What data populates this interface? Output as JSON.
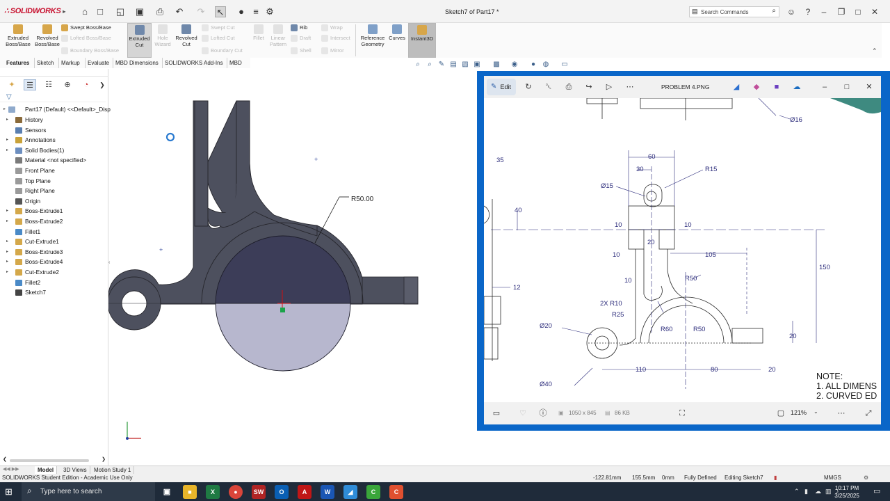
{
  "app": {
    "name": "SOLIDWORKS",
    "document_title": "Sketch7 of Part17 *"
  },
  "search": {
    "placeholder": "Search Commands"
  },
  "command_manager": {
    "extruded_boss": "Extruded\nBoss/Base",
    "revolved_boss": "Revolved\nBoss/Base",
    "swept_boss": "Swept Boss/Base",
    "lofted_boss": "Lofted Boss/Base",
    "boundary_boss": "Boundary Boss/Base",
    "extruded_cut": "Extruded\nCut",
    "hole_wizard": "Hole\nWizard",
    "revolved_cut": "Revolved\nCut",
    "swept_cut": "Swept Cut",
    "lofted_cut": "Lofted Cut",
    "boundary_cut": "Boundary Cut",
    "fillet": "Fillet",
    "linear_pattern": "Linear\nPattern",
    "rib": "Rib",
    "draft": "Draft",
    "shell": "Shell",
    "wrap": "Wrap",
    "intersect": "Intersect",
    "mirror": "Mirror",
    "reference_geometry": "Reference\nGeometry",
    "curves": "Curves",
    "instant3d": "Instant3D"
  },
  "tabs": [
    "Features",
    "Sketch",
    "Markup",
    "Evaluate",
    "MBD Dimensions",
    "SOLIDWORKS Add-Ins",
    "MBD"
  ],
  "tree": {
    "root": "Part17 (Default) <<Default>_Disp",
    "items": [
      {
        "label": "History",
        "arrow": true,
        "icon": "history-icon",
        "color": "#8a6a3a"
      },
      {
        "label": "Sensors",
        "arrow": false,
        "icon": "sensors-icon",
        "color": "#5a7fb0"
      },
      {
        "label": "Annotations",
        "arrow": true,
        "icon": "annotations-icon",
        "color": "#c9a23a"
      },
      {
        "label": "Solid Bodies(1)",
        "arrow": true,
        "icon": "solid-bodies-icon",
        "color": "#6c8ebf"
      },
      {
        "label": "Material <not specified>",
        "arrow": false,
        "icon": "material-icon",
        "color": "#7a7a7a"
      },
      {
        "label": "Front Plane",
        "arrow": false,
        "icon": "plane-icon",
        "color": "#9a9a9a"
      },
      {
        "label": "Top Plane",
        "arrow": false,
        "icon": "plane-icon",
        "color": "#9a9a9a"
      },
      {
        "label": "Right Plane",
        "arrow": false,
        "icon": "plane-icon",
        "color": "#9a9a9a"
      },
      {
        "label": "Origin",
        "arrow": false,
        "icon": "origin-icon",
        "color": "#555555"
      },
      {
        "label": "Boss-Extrude1",
        "arrow": true,
        "icon": "boss-extrude-icon",
        "color": "#d4a84a"
      },
      {
        "label": "Boss-Extrude2",
        "arrow": true,
        "icon": "boss-extrude-icon",
        "color": "#d4a84a"
      },
      {
        "label": "Fillet1",
        "arrow": false,
        "icon": "fillet-icon",
        "color": "#4a8ac7"
      },
      {
        "label": "Cut-Extrude1",
        "arrow": true,
        "icon": "cut-extrude-icon",
        "color": "#d4a84a"
      },
      {
        "label": "Boss-Extrude3",
        "arrow": true,
        "icon": "boss-extrude-icon",
        "color": "#d4a84a"
      },
      {
        "label": "Boss-Extrude4",
        "arrow": true,
        "icon": "boss-extrude-icon",
        "color": "#d4a84a"
      },
      {
        "label": "Cut-Extrude2",
        "arrow": true,
        "icon": "cut-extrude-icon",
        "color": "#d4a84a"
      },
      {
        "label": "Fillet2",
        "arrow": false,
        "icon": "fillet-icon",
        "color": "#4a8ac7"
      },
      {
        "label": "Sketch7",
        "arrow": false,
        "icon": "sketch-icon",
        "color": "#444444"
      }
    ]
  },
  "canvas": {
    "dimension_label": "R50.00"
  },
  "viewer": {
    "edit_label": "Edit",
    "title": "PROBLEM 4.PNG",
    "image_size": "1050 x 845",
    "file_size": "86 KB",
    "zoom": "121%",
    "dims": {
      "d60": "60",
      "d30": "30",
      "r15": "R15",
      "dia15": "Ø15",
      "d35": "35",
      "d40": "40",
      "d10a": "10",
      "d10b": "10",
      "d20a": "20",
      "d10c": "10",
      "d105": "105",
      "d150": "150",
      "d10d": "10",
      "r50a": "R50",
      "d12": "12",
      "r10": "2X R10",
      "r25": "R25",
      "r60": "R60",
      "r50b": "R50",
      "dia20": "Ø20",
      "d20b": "20",
      "d110": "110",
      "d80": "80",
      "d20c": "20",
      "dia40": "Ø40",
      "dia16": "Ø16"
    },
    "note_lines": [
      "NOTE:",
      "1. ALL DIMENS",
      "2. CURVED ED"
    ]
  },
  "bottom_tabs": [
    "Model",
    "3D Views",
    "Motion Study 1"
  ],
  "status": {
    "edition": "SOLIDWORKS Student Edition - Academic Use Only",
    "x": "-122.81mm",
    "y": "155.5mm",
    "z": "0mm",
    "state": "Fully Defined",
    "editing": "Editing Sketch7",
    "units": "MMGS"
  },
  "taskbar": {
    "search_placeholder": "Type here to search",
    "time": "10:17 PM",
    "date": "3/25/2025"
  },
  "colors": {
    "accent": "#0a66c8",
    "solid_body": "#4d505e",
    "cut_region": "#3c3d58",
    "section_fill": "#b7b7ce",
    "taskbar": "#1f2b3a"
  }
}
